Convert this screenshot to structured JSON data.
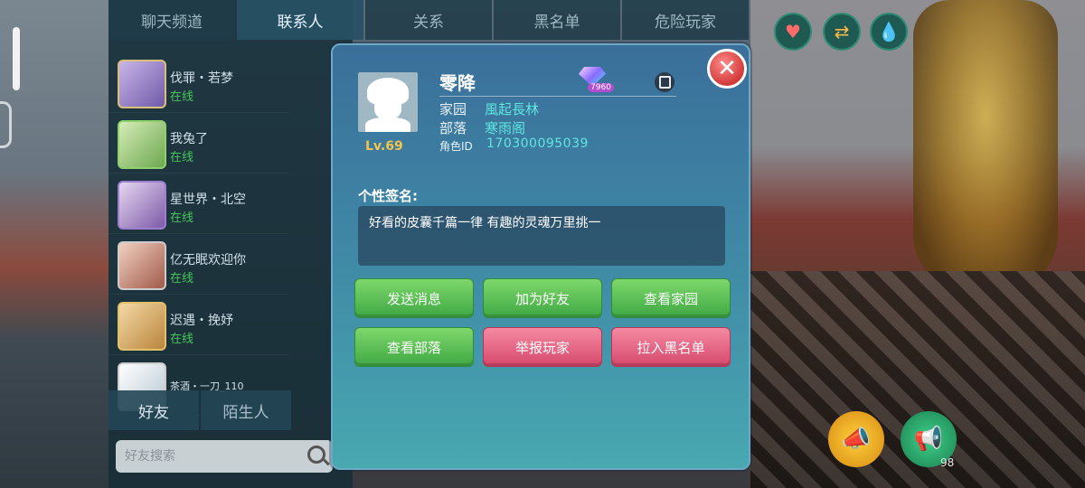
{
  "top_tabs": [
    "聊天频道",
    "联系人",
    "关系",
    "黑名单",
    "危险玩家"
  ],
  "contacts": [
    {
      "name": "伐罪・若梦",
      "status": "在线"
    },
    {
      "name": "我兔了",
      "status": "在线"
    },
    {
      "name": "星世界・北空",
      "status": "在线"
    },
    {
      "name": "亿无眠欢迎你",
      "status": "在线"
    },
    {
      "name": "迟遇・挽妤",
      "status": "在线"
    },
    {
      "name": "茶酒・一刀_110",
      "status": ""
    }
  ],
  "bottom_tabs": [
    "好友",
    "陌生人"
  ],
  "search": {
    "placeholder": "好友搜索"
  },
  "top_right_icons": [
    "heart-icon",
    "swap-icon",
    "drop-icon"
  ],
  "megaphones": {
    "count": "98"
  },
  "profile": {
    "name": "零降",
    "level": "Lv.69",
    "diamond_value": "7960",
    "homeland_label": "家园",
    "homeland_value": "風起長林",
    "tribe_label": "部落",
    "tribe_value": "寒雨阁",
    "id_label": "角色ID",
    "id_value": "170300095039",
    "signature_label": "个性签名:",
    "signature": "好看的皮囊千篇一律 有趣的灵魂万里挑一"
  },
  "buttons": {
    "send_message": "发送消息",
    "add_friend": "加为好友",
    "view_homeland": "查看家园",
    "view_tribe": "查看部落",
    "report_player": "举报玩家",
    "blacklist": "拉入黑名单"
  },
  "colors": {
    "accent_cyan": "#5fe7e0",
    "button_green": "#3fa844",
    "button_pink": "#d6486d",
    "level_gold": "#f2c44a",
    "online_green": "#46c65a"
  }
}
